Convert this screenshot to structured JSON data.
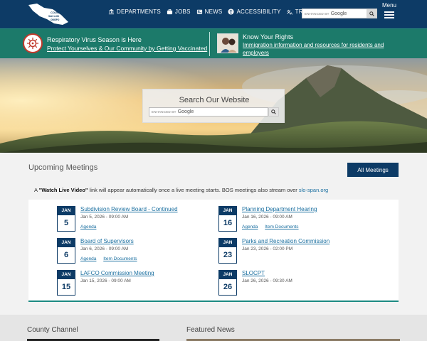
{
  "header": {
    "logo_text": "COUNTY OF SAN LUIS OBISPO",
    "nav": [
      {
        "label": "DEPARTMENTS",
        "icon": "building-icon"
      },
      {
        "label": "JOBS",
        "icon": "briefcase-icon"
      },
      {
        "label": "NEWS",
        "icon": "newspaper-icon"
      },
      {
        "label": "ACCESSIBILITY",
        "icon": "accessibility-icon"
      },
      {
        "label": "TRANSLATE",
        "icon": "translate-icon"
      }
    ],
    "search_enhanced": "ENHANCED BY",
    "search_google": "Google",
    "menu_label": "Menu"
  },
  "alert": {
    "title": "Respiratory Virus Season is Here",
    "link": "Protect Yourselves & Our Community by Getting Vaccinated",
    "rights_title": "Know Your Rights",
    "rights_link": "Immigration information and resources for residents and employers"
  },
  "hero": {
    "search_title": "Search Our Website",
    "search_enhanced": "ENHANCED BY",
    "search_google": "Google"
  },
  "meetings": {
    "title": "Upcoming Meetings",
    "all_button": "All Meetings",
    "note_prefix": "A",
    "note_bold": "\"Watch Live Video\"",
    "note_middle": "link will appear automatically once a live meeting starts. BOS meetings also stream over",
    "note_link": "slo-span.org",
    "items": [
      {
        "month": "JAN",
        "day": "5",
        "title": "Subdivision Review Board - Continued",
        "date": "Jan  5, 2026 - 09:00 AM",
        "links": [
          "Agenda"
        ]
      },
      {
        "month": "JAN",
        "day": "6",
        "title": "Board of Supervisors",
        "date": "Jan  6, 2026 - 09:00 AM",
        "links": [
          "Agenda",
          "Item Documents"
        ]
      },
      {
        "month": "JAN",
        "day": "15",
        "title": "LAFCO Commission Meeting",
        "date": "Jan 15, 2026 - 09:00 AM",
        "links": []
      },
      {
        "month": "JAN",
        "day": "16",
        "title": "Planning Department Hearing",
        "date": "Jan 16, 2026 - 09:00 AM",
        "links": [
          "Agenda",
          "Item Documents"
        ]
      },
      {
        "month": "JAN",
        "day": "23",
        "title": "Parks and Recreation Commission",
        "date": "Jan 23, 2026 - 02:00 PM",
        "links": []
      },
      {
        "month": "JAN",
        "day": "26",
        "title": "SLOCPT",
        "date": "Jan 26, 2026 - 09:30 AM",
        "links": []
      }
    ]
  },
  "bottom": {
    "county_channel": "County Channel",
    "featured_news": "Featured News"
  },
  "colors": {
    "header": "#0d3b66",
    "alert": "#1c7a6a",
    "accent": "#1c8a82",
    "link": "#1a6fa0"
  }
}
